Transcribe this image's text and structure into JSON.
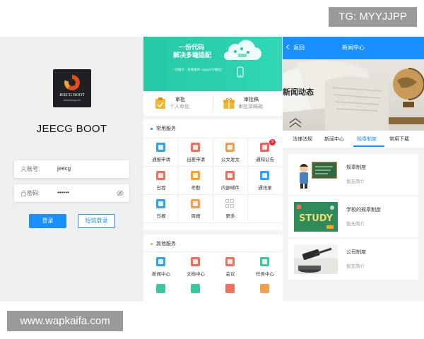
{
  "watermarks": {
    "tg": "TG: MYYJJPP",
    "site": "www.wapkaifa.com"
  },
  "login": {
    "logo_text": "JEECG BOOT",
    "logo_sub": "www.jeecg.com",
    "title": "JEECG BOOT",
    "username_label": "账号:",
    "username_value": "jeecg",
    "password_label": "密码:",
    "password_value": "••••••",
    "login_button": "登录",
    "sms_button": "短信登录",
    "colors": {
      "primary": "#1890ff"
    }
  },
  "home": {
    "banner": {
      "line1": "一份代码",
      "line2": "解决多端适配",
      "line3": "一次编写 · 多端发布 (app/h5/微信)"
    },
    "approval": [
      {
        "title": "审批",
        "subtitle": "个人审批"
      },
      {
        "title": "审批稿",
        "subtitle": "审批草稿箱"
      }
    ],
    "common_services": {
      "title": "常用服务",
      "items": [
        {
          "label": "通报申请",
          "color": "#2ea3f2"
        },
        {
          "label": "出差申请",
          "color": "#f07060"
        },
        {
          "label": "公文发文",
          "color": "#f0a050"
        },
        {
          "label": "通知公告",
          "color": "#f06262",
          "badge": "9"
        },
        {
          "label": "日程",
          "color": "#f07060"
        },
        {
          "label": "考勤",
          "color": "#f5a623"
        },
        {
          "label": "内部邮件",
          "color": "#f07060"
        },
        {
          "label": "通讯录",
          "color": "#2ea3f2"
        },
        {
          "label": "日报",
          "color": "#2ea3f2"
        },
        {
          "label": "周报",
          "color": "#f0a050"
        },
        {
          "label": "更多",
          "color": "#bbbbbb"
        }
      ]
    },
    "other_services": {
      "title": "其他服务",
      "items": [
        {
          "label": "新闻中心",
          "color": "#2ea3f2"
        },
        {
          "label": "文档中心",
          "color": "#f07060"
        },
        {
          "label": "会议",
          "color": "#f07060"
        },
        {
          "label": "任务中心",
          "color": "#3cc7a0"
        }
      ]
    }
  },
  "news": {
    "back": "返回",
    "title": "新闻中心",
    "hero_text": "新闻动态",
    "tabs": [
      "法律法规",
      "新闻中心",
      "规章制度",
      "常用下载"
    ],
    "active_tab": "规章制度",
    "articles": [
      {
        "title": "规章制度",
        "subtitle": "暂无简介",
        "image": "teacher-blackboard"
      },
      {
        "title": "学校的规章制度",
        "subtitle": "暂无简介",
        "image": "study"
      },
      {
        "title": "公司制度",
        "subtitle": "暂无简介",
        "image": "gavel"
      }
    ]
  }
}
